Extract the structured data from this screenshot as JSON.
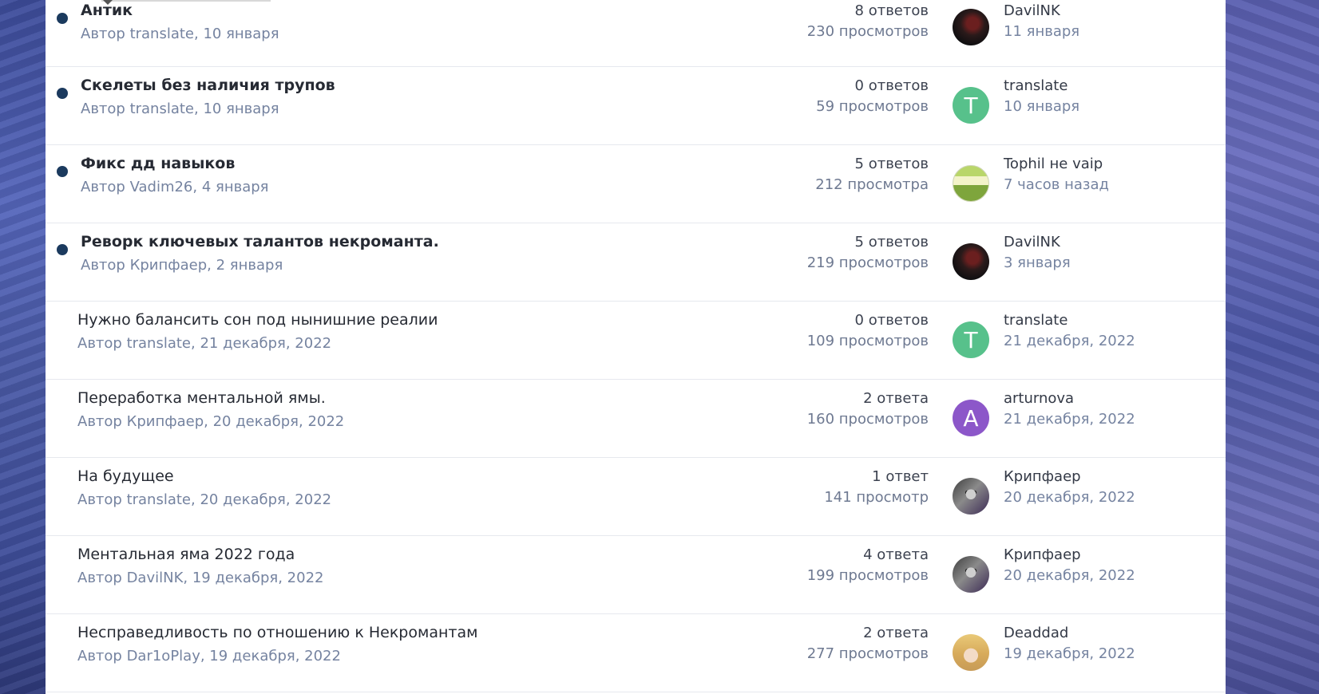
{
  "topics": [
    {
      "title": "Антик",
      "meta": "Автор translate, 10 января",
      "replies": "8 ответов",
      "views": "230 просмотров",
      "last_user": "DavilNK",
      "last_date": "11 января",
      "unread": true,
      "avatar": "dark-portrait-icon",
      "avatar_letter": ""
    },
    {
      "title": "Скелеты без наличия трупов",
      "meta": "Автор translate, 10 января",
      "replies": "0 ответов",
      "views": "59 просмотров",
      "last_user": "translate",
      "last_date": "10 января",
      "unread": true,
      "avatar": "letter-t",
      "avatar_letter": "T"
    },
    {
      "title": "Фикс дд навыков",
      "meta": "Автор Vadim26, 4 января",
      "replies": "5 ответов",
      "views": "212 просмотра",
      "last_user": "Tophil не vaip",
      "last_date": "7 часов назад",
      "unread": true,
      "avatar": "green-portrait-icon",
      "avatar_letter": ""
    },
    {
      "title": "Реворк ключевых талантов некроманта.",
      "meta": "Автор Крипфаер, 2 января",
      "replies": "5 ответов",
      "views": "219 просмотров",
      "last_user": "DavilNK",
      "last_date": "3 января",
      "unread": true,
      "avatar": "dark-portrait-icon",
      "avatar_letter": ""
    },
    {
      "title": "Нужно балансить сон под нынишние реалии",
      "meta": "Автор translate, 21 декабря, 2022",
      "replies": "0 ответов",
      "views": "109 просмотров",
      "last_user": "translate",
      "last_date": "21 декабря, 2022",
      "unread": false,
      "avatar": "letter-t",
      "avatar_letter": "T"
    },
    {
      "title": "Переработка ментальной ямы.",
      "meta": "Автор Крипфаер, 20 декабря, 2022",
      "replies": "2 ответа",
      "views": "160 просмотров",
      "last_user": "arturnova",
      "last_date": "21 декабря, 2022",
      "unread": false,
      "avatar": "letter-a",
      "avatar_letter": "A"
    },
    {
      "title": "На будущее",
      "meta": "Автор translate, 20 декабря, 2022",
      "replies": "1 ответ",
      "views": "141 просмотр",
      "last_user": "Крипфаер",
      "last_date": "20 декабря, 2022",
      "unread": false,
      "avatar": "skull-portrait-icon",
      "avatar_letter": ""
    },
    {
      "title": "Ментальная яма 2022 года",
      "meta": "Автор DavilNK, 19 декабря, 2022",
      "replies": "4 ответа",
      "views": "199 просмотров",
      "last_user": "Крипфаер",
      "last_date": "20 декабря, 2022",
      "unread": false,
      "avatar": "skull-portrait-icon",
      "avatar_letter": ""
    },
    {
      "title": "Несправедливость по отношению к Некромантам",
      "meta": "Автор Dar1oPlay, 19 декабря, 2022",
      "replies": "2 ответа",
      "views": "277 просмотров",
      "last_user": "Deaddad",
      "last_date": "19 декабря, 2022",
      "unread": false,
      "avatar": "blonde-portrait-icon",
      "avatar_letter": ""
    }
  ]
}
